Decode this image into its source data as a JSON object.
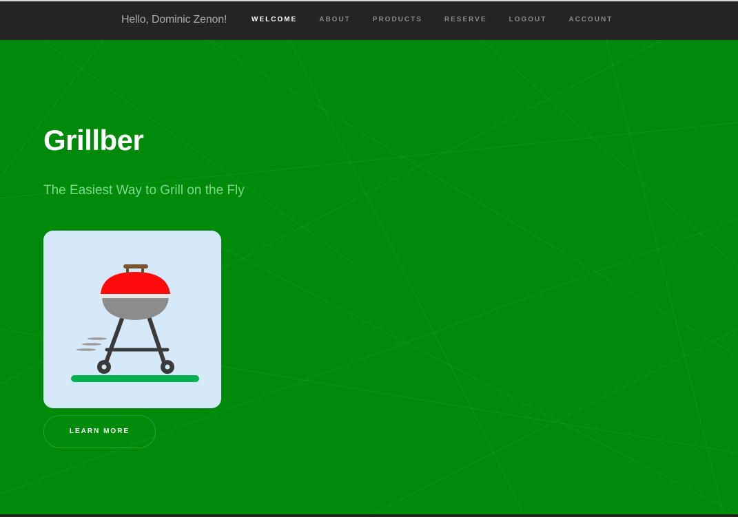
{
  "header": {
    "greeting": "Hello, Dominic Zenon!",
    "nav": [
      {
        "label": "WELCOME",
        "active": true
      },
      {
        "label": "ABOUT",
        "active": false
      },
      {
        "label": "PRODUCTS",
        "active": false
      },
      {
        "label": "RESERVE",
        "active": false
      },
      {
        "label": "LOGOUT",
        "active": false
      },
      {
        "label": "ACCOUNT",
        "active": false
      }
    ]
  },
  "hero": {
    "title": "Grillber",
    "subtitle": "The Easiest Way to Grill on the Fly",
    "illustration": "grill-icon",
    "button_label": "LEARN MORE"
  },
  "colors": {
    "hero_background": "#008a09",
    "header_background": "#242424",
    "subtitle": "#7ddc8a",
    "card_background": "#d6e9f8",
    "grill_lid": "#ff0a0a",
    "grill_bowl": "#8c8c8c",
    "grass": "#00b14f"
  }
}
